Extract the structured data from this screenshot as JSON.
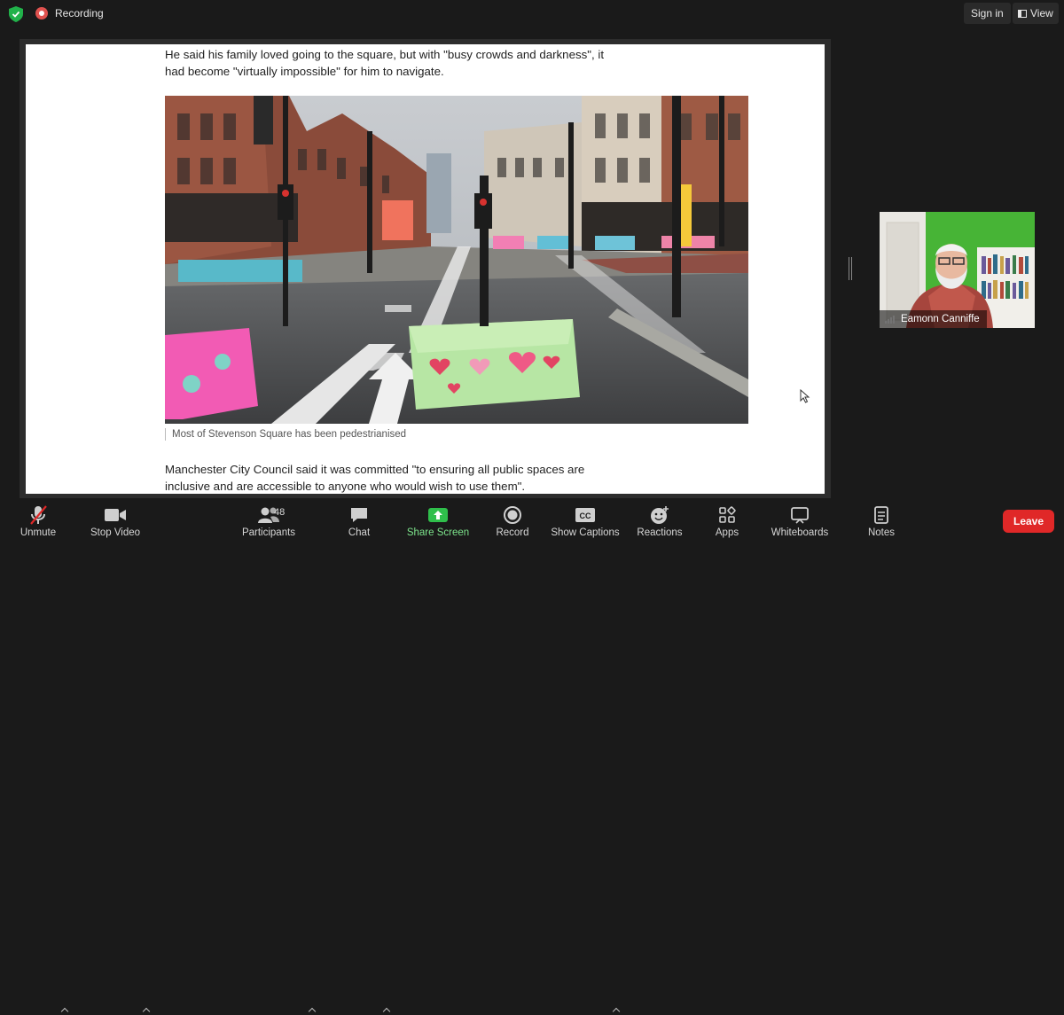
{
  "topbar": {
    "recording_label": "Recording",
    "sign_in_label": "Sign in",
    "view_label": "View"
  },
  "article": {
    "paragraph_1": "He said his family loved going to the square, but with \"busy crowds and darkness\", it had become \"virtually impossible\" for him to navigate.",
    "caption": "Most of Stevenson Square has been pedestrianised",
    "paragraph_2": "Manchester City Council said it was committed \"to ensuring all public spaces are inclusive and are accessible to anyone who would wish to use them\"."
  },
  "participant_video": {
    "name": "Eamonn Canniffe"
  },
  "toolbar": {
    "unmute": "Unmute",
    "stop_video": "Stop Video",
    "participants": "Participants",
    "participants_count": "48",
    "chat": "Chat",
    "share_screen": "Share Screen",
    "record": "Record",
    "show_captions": "Show Captions",
    "reactions": "Reactions",
    "apps": "Apps",
    "whiteboards": "Whiteboards",
    "notes": "Notes",
    "leave": "Leave"
  },
  "colors": {
    "accent_green": "#7ce38b",
    "leave_red": "#e02828",
    "record_red": "#e0524f"
  },
  "icons": [
    "shield-icon",
    "microphone-muted-icon",
    "video-camera-icon",
    "participants-icon",
    "chat-bubble-icon",
    "share-screen-icon",
    "record-icon",
    "captions-icon",
    "reactions-icon",
    "apps-icon",
    "whiteboard-icon",
    "notes-icon"
  ]
}
